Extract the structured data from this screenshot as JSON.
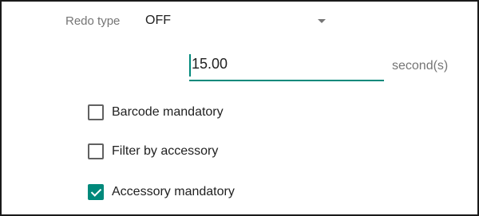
{
  "redo": {
    "label": "Redo type",
    "value": "OFF",
    "arrow_icon": "dropdown-arrow-icon"
  },
  "timer": {
    "value": "15.00",
    "unit": "second(s)"
  },
  "options": [
    {
      "label": "Barcode mandatory",
      "checked": false
    },
    {
      "label": "Filter by accessory",
      "checked": false
    },
    {
      "label": "Accessory mandatory",
      "checked": true
    }
  ],
  "colors": {
    "accent": "#00897b",
    "muted_text": "#757575",
    "text": "#212121"
  }
}
